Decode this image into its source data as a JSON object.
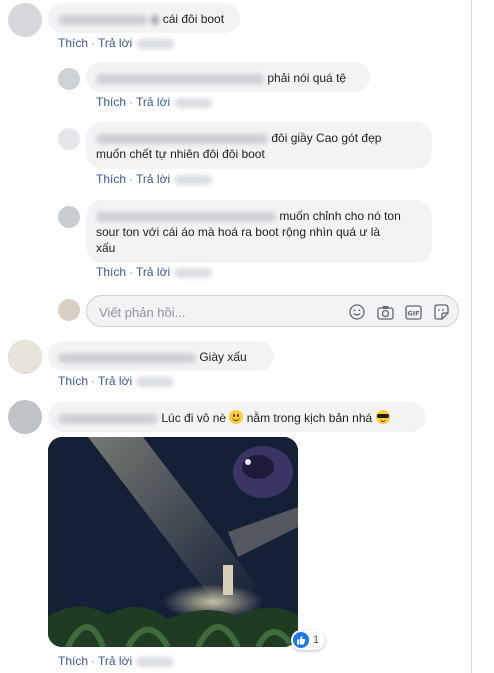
{
  "actions": {
    "like": "Thích",
    "reply": "Trả lời",
    "separator": "·"
  },
  "comments": [
    {
      "text": "cái đôi boot"
    },
    {
      "text": "phải nói quá tệ"
    },
    {
      "text_line1": "đôi giầy Cao gót đẹp",
      "text_line2": "muốn chết tự nhiên đôi đôi boot"
    },
    {
      "text_line1": "muốn chỉnh cho nó ton",
      "text_line2": "sour ton với cái áo mà hoá ra boot rộng nhìn quá ư là",
      "text_line3": "xấu"
    },
    {
      "text": "Giày xấu"
    },
    {
      "text_before": "Lúc đi vô nè",
      "text_middle": "nằm trong kịch bản nhá",
      "reactions": "1"
    }
  ],
  "reply_box": {
    "placeholder": "Viết phản hồi..."
  },
  "colors": {
    "link": "#385898",
    "bubble": "#f2f3f5",
    "like_blue": "#1877f2"
  },
  "icons": [
    "emoji-icon",
    "camera-icon",
    "gif-icon",
    "sticker-icon",
    "like-icon"
  ]
}
